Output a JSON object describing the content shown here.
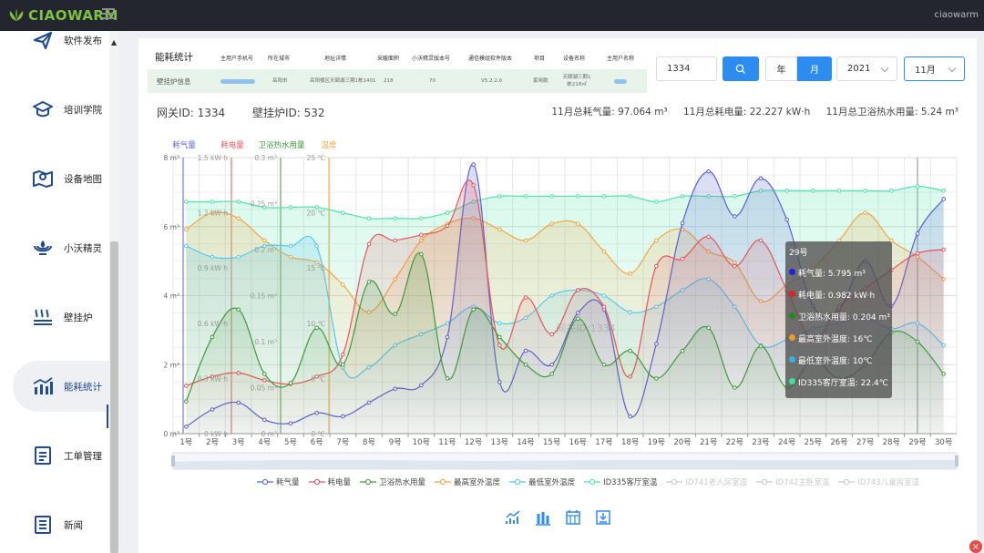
{
  "app": {
    "logo_text": "CIAOWARM",
    "user_name": "ciaowarm"
  },
  "sidebar": {
    "items": [
      {
        "label": "软件发布",
        "icon": "paper-plane-icon"
      },
      {
        "label": "培训学院",
        "icon": "graduation-cap-icon"
      },
      {
        "label": "设备地图",
        "icon": "map-pin-icon"
      },
      {
        "label": "小沃精灵",
        "icon": "spirit-icon"
      },
      {
        "label": "壁挂炉",
        "icon": "heater-icon"
      },
      {
        "label": "能耗统计",
        "icon": "bar-chart-icon",
        "active": true
      },
      {
        "label": "工单管理",
        "icon": "work-order-icon"
      },
      {
        "label": "新闻",
        "icon": "news-icon"
      }
    ]
  },
  "info_table": {
    "title": "能耗统计",
    "row_title": "壁挂炉信息",
    "headers": [
      "主用户手机号",
      "所在城市",
      "地址详情",
      "采暖面积",
      "小沃精灵版本号",
      "通信模组软件版本",
      "项目",
      "设备名称",
      "主用户名称"
    ],
    "values": [
      "",
      "岳阳市",
      "岳阳楼区天颐湖三期1栋1401",
      "218",
      "70",
      "V5.2.2.0",
      "家用款",
      "天颐湖三期1栋218㎡",
      ""
    ]
  },
  "filters": {
    "gateway_value": "1334",
    "year_label": "年",
    "month_label": "月",
    "year_selected": "2021",
    "month_selected": "11月"
  },
  "summary": {
    "gateway_id": "网关ID: 1334",
    "boiler_id": "壁挂炉ID: 532",
    "gas_total": "11月总耗气量: 97.064 m³",
    "power_total": "11月总耗电量: 22.227 kW·h",
    "water_total": "11月总卫浴热水用量: 5.24 m³"
  },
  "colors": {
    "gas": "#5a5fd6",
    "power": "#e8545a",
    "water": "#3e9a3a",
    "temp_high": "#f2a640",
    "temp_low": "#55c8ea",
    "living_room": "#4ee3a8",
    "disabled": "#c9c9c9",
    "primary": "#2d8cf0"
  },
  "chart_data": {
    "type": "line",
    "watermark": "网关ID:1334",
    "categories": [
      "1号",
      "2号",
      "3号",
      "4号",
      "5号",
      "6号",
      "7号",
      "8号",
      "9号",
      "10号",
      "11号",
      "12号",
      "13号",
      "14号",
      "15号",
      "16号",
      "17号",
      "18号",
      "19号",
      "20号",
      "21号",
      "22号",
      "23号",
      "24号",
      "25号",
      "26号",
      "27号",
      "28号",
      "29号",
      "30号"
    ],
    "axes": [
      {
        "name": "耗气量",
        "unit": "m³",
        "min": 0,
        "max": 8,
        "ticks": [
          "0 m³",
          "2 m³",
          "4 m³",
          "6 m³",
          "8 m³"
        ]
      },
      {
        "name": "耗电量",
        "unit": "kW·h",
        "min": 0,
        "max": 1.5,
        "ticks": [
          "0 kW·h",
          "0.3 kW·h",
          "0.6 kW·h",
          "0.9 kW·h",
          "1.2 kW·h",
          "1.5 kW·h"
        ]
      },
      {
        "name": "卫浴热水用量",
        "unit": "m³",
        "min": 0,
        "max": 0.3,
        "ticks": [
          "0 m³",
          "0.05 m³",
          "0.1 m³",
          "0.15 m³",
          "0.2 m³",
          "0.25 m³",
          "0.3 m³"
        ]
      },
      {
        "name": "温度",
        "unit": "℃",
        "min": 0,
        "max": 25,
        "ticks": [
          "0 ℃",
          "5 ℃",
          "10 ℃",
          "15 ℃",
          "20 ℃",
          "25 ℃"
        ]
      }
    ],
    "series": [
      {
        "name": "耗气量",
        "axis": 0,
        "values": [
          0.2,
          0.7,
          0.9,
          0.4,
          0.3,
          0.6,
          0.5,
          0.9,
          1.3,
          1.4,
          2.8,
          7.8,
          1.5,
          2.4,
          2.0,
          3.5,
          3.6,
          0.5,
          2.6,
          6.1,
          7.6,
          6.3,
          7.4,
          6.2,
          3.7,
          3.6,
          5.0,
          3.7,
          5.8,
          6.8
        ]
      },
      {
        "name": "耗电量",
        "axis": 1,
        "values": [
          0.26,
          0.31,
          0.33,
          0.29,
          0.27,
          0.31,
          0.43,
          1.03,
          1.05,
          1.08,
          1.13,
          1.35,
          0.48,
          0.74,
          0.54,
          0.78,
          0.69,
          0.31,
          0.91,
          0.95,
          1.07,
          0.91,
          1.05,
          0.78,
          0.51,
          0.69,
          0.79,
          0.89,
          0.98,
          1.0
        ]
      },
      {
        "name": "卫浴热水用量",
        "axis": 2,
        "values": [
          0.035,
          0.105,
          0.135,
          0.065,
          0.055,
          0.115,
          0.075,
          0.165,
          0.13,
          0.195,
          0.06,
          0.135,
          0.105,
          0.075,
          0.065,
          0.125,
          0.075,
          0.09,
          0.06,
          0.09,
          0.115,
          0.05,
          0.095,
          0.05,
          0.08,
          0.06,
          0.075,
          0.11,
          0.1,
          0.065
        ]
      },
      {
        "name": "最高室外温度",
        "axis": 3,
        "values": [
          18.5,
          20.0,
          19.5,
          17.5,
          16.0,
          15.5,
          13.5,
          11.0,
          14.0,
          17.5,
          19.0,
          19.5,
          18.5,
          17.5,
          19.0,
          19.0,
          16.5,
          14.5,
          17.5,
          18.5,
          16.5,
          15.5,
          12.0,
          13.5,
          15.0,
          17.5,
          20.0,
          17.5,
          16.0,
          14.0
        ]
      },
      {
        "name": "最低室外温度",
        "axis": 3,
        "values": [
          17.0,
          16.0,
          16.0,
          17.0,
          17.0,
          17.0,
          6.0,
          6.0,
          8.0,
          9.0,
          10.0,
          11.5,
          10.0,
          10.5,
          12.5,
          13.0,
          12.5,
          11.0,
          11.5,
          13.0,
          14.0,
          11.5,
          8.0,
          8.5,
          9.5,
          10.0,
          10.5,
          9.5,
          10.0,
          8.0
        ]
      },
      {
        "name": "ID335客厅室温",
        "axis": 3,
        "values": [
          21.0,
          21.0,
          21.0,
          20.5,
          20.5,
          20.5,
          20.0,
          19.5,
          19.5,
          19.5,
          20.0,
          21.0,
          21.5,
          21.5,
          21.5,
          21.5,
          21.5,
          21.5,
          21.0,
          21.5,
          21.5,
          21.5,
          22.0,
          22.0,
          22.0,
          22.0,
          22.0,
          22.0,
          22.4,
          22.0
        ]
      }
    ],
    "legend": [
      "耗气量",
      "耗电量",
      "卫浴热水用量",
      "最高室外温度",
      "最低室外温度",
      "ID335客厅室温",
      "ID741老人房室温",
      "ID742主卧室温",
      "ID743儿童房室温"
    ],
    "legend_disabled": [
      "ID741老人房室温",
      "ID742主卧室温",
      "ID743儿童房室温"
    ],
    "tooltip": {
      "title": "29号",
      "rows": [
        "耗气量: 5.795 m³",
        "耗电量: 0.982 kW·h",
        "卫浴热水用量: 0.204 m³",
        "最高室外温度: 16℃",
        "最低室外温度: 10℃",
        "ID335客厅室温: 22.4℃"
      ]
    }
  },
  "toolbox": [
    {
      "icon": "line-chart-icon"
    },
    {
      "icon": "bar-chart-icon"
    },
    {
      "icon": "data-view-icon"
    },
    {
      "icon": "save-image-icon"
    }
  ],
  "close_badge": "×"
}
